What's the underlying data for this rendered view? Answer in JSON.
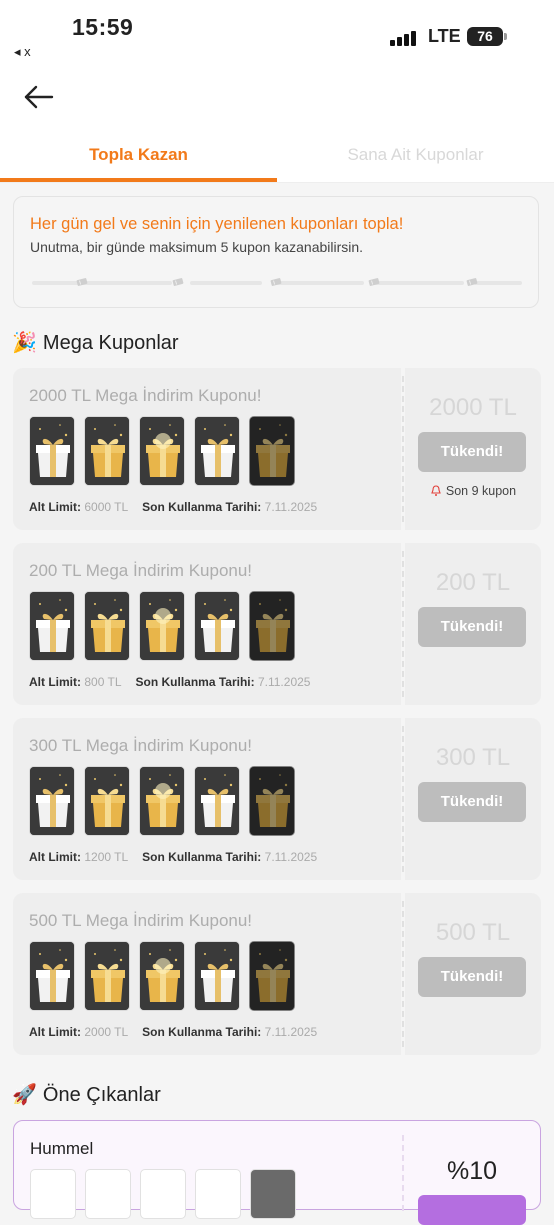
{
  "status_bar": {
    "time": "15:59",
    "back_app": "◂ x",
    "network": "LTE",
    "battery": "76"
  },
  "tabs": {
    "active": "Topla Kazan",
    "inactive": "Sana Ait Kuponlar"
  },
  "info": {
    "title": "Her gün gel ve senin için yenilenen kuponları topla!",
    "subtitle": "Unutma, bir günde maksimum 5 kupon kazanabilirsin.",
    "progress_collected": 0,
    "progress_total": 5
  },
  "mega_section": {
    "emoji": "🎉",
    "title": "Mega Kuponlar"
  },
  "coupons": [
    {
      "title": "2000 TL Mega İndirim Kuponu!",
      "amount": "2000 TL",
      "min_label": "Alt Limit:",
      "min_value": "6000 TL",
      "expiry_label": "Son Kullanma Tarihi:",
      "expiry_value": "7.11.2025",
      "button": "Tükendi!",
      "remaining": "Son 9 kupon"
    },
    {
      "title": "200 TL Mega İndirim Kuponu!",
      "amount": "200 TL",
      "min_label": "Alt Limit:",
      "min_value": "800 TL",
      "expiry_label": "Son Kullanma Tarihi:",
      "expiry_value": "7.11.2025",
      "button": "Tükendi!"
    },
    {
      "title": "300 TL Mega İndirim Kuponu!",
      "amount": "300 TL",
      "min_label": "Alt Limit:",
      "min_value": "1200 TL",
      "expiry_label": "Son Kullanma Tarihi:",
      "expiry_value": "7.11.2025",
      "button": "Tükendi!"
    },
    {
      "title": "500 TL Mega İndirim Kuponu!",
      "amount": "500 TL",
      "min_label": "Alt Limit:",
      "min_value": "2000 TL",
      "expiry_label": "Son Kullanma Tarihi:",
      "expiry_value": "7.11.2025",
      "button": "Tükendi!"
    }
  ],
  "featured_section": {
    "emoji": "🚀",
    "title": "Öne Çıkanlar"
  },
  "featured": {
    "brand": "Hummel",
    "discount": "%10"
  },
  "colors": {
    "accent": "#f27a1a",
    "featured_accent": "#b46ee0",
    "disabled_button": "#bdbdbd"
  }
}
